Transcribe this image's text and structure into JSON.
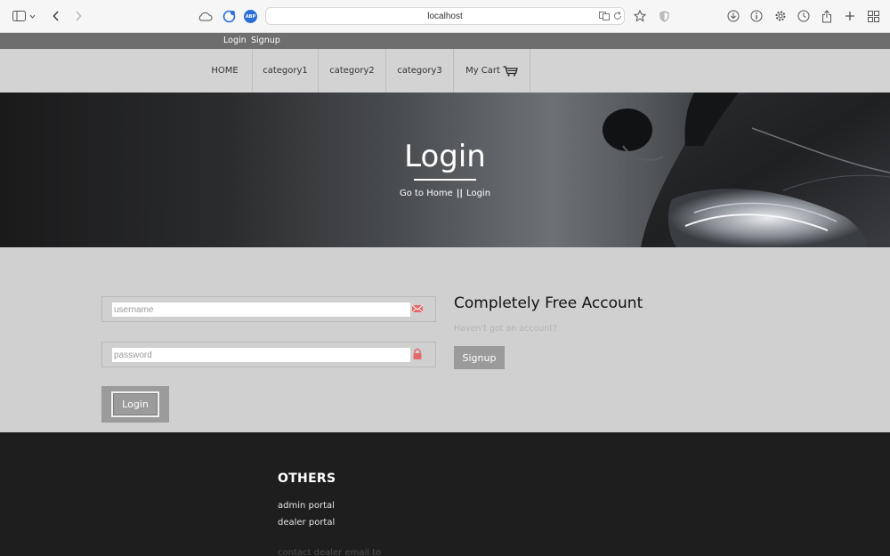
{
  "browser": {
    "url": "localhost",
    "abp_label": "ABP",
    "icons": [
      "sidebar-icon",
      "chevron-down-icon",
      "back-icon",
      "forward-icon",
      "cloud-icon",
      "refresh-badge-icon",
      "adblock-icon",
      "translate-icon",
      "reload-icon",
      "star-icon",
      "shield-icon",
      "download-icon",
      "info-icon",
      "settings-icon",
      "history-icon",
      "share-icon",
      "new-tab-icon",
      "tabs-grid-icon"
    ]
  },
  "topbar": {
    "login": "Login",
    "signup": "Signup"
  },
  "nav": {
    "items": [
      "HOME",
      "category1",
      "category2",
      "category3"
    ],
    "cart": "My Cart"
  },
  "hero": {
    "title": "Login",
    "crumb_home": "Go to Home",
    "crumb_sep": "||",
    "crumb_current": "Login"
  },
  "form": {
    "username_placeholder": "username",
    "password_placeholder": "password",
    "login_button": "Login"
  },
  "promo": {
    "title": "Completely Free Account",
    "subtitle": "Haven't got an account?",
    "signup_button": "Signup"
  },
  "footer": {
    "heading": "OTHERS",
    "links": [
      "admin portal",
      "dealer portal"
    ],
    "faded_text": "contact dealer email to"
  },
  "colors": {
    "accent_icon": "#e36a6a",
    "button_gray": "#9b9b9b",
    "nav_bg": "#d3d3d3",
    "topbar_bg": "#6e6e6e"
  }
}
